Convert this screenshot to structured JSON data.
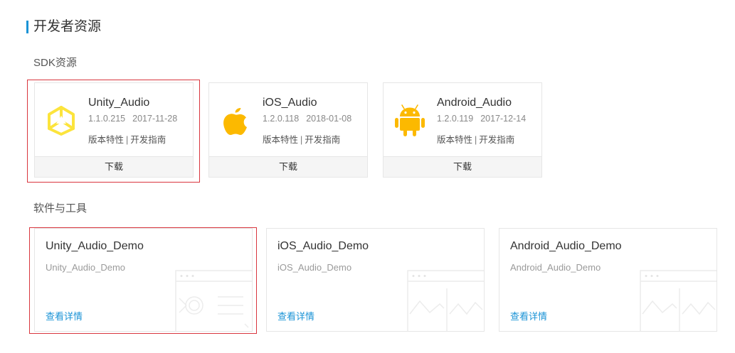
{
  "page_title": "开发者资源",
  "sdk_section": {
    "label": "SDK资源",
    "cards": [
      {
        "name": "Unity_Audio",
        "version": "1.1.0.215",
        "date": "2017-11-28",
        "release_notes": "版本特性",
        "separator": "|",
        "guide": "开发指南",
        "download": "下载",
        "icon": "unity-icon",
        "icon_color": "#fce43c"
      },
      {
        "name": "iOS_Audio",
        "version": "1.2.0.118",
        "date": "2018-01-08",
        "release_notes": "版本特性",
        "separator": "|",
        "guide": "开发指南",
        "download": "下载",
        "icon": "apple-icon",
        "icon_color": "#fcb900"
      },
      {
        "name": "Android_Audio",
        "version": "1.2.0.119",
        "date": "2017-12-14",
        "release_notes": "版本特性",
        "separator": "|",
        "guide": "开发指南",
        "download": "下载",
        "icon": "android-icon",
        "icon_color": "#fcb900"
      }
    ]
  },
  "tools_section": {
    "label": "软件与工具",
    "cards": [
      {
        "name": "Unity_Audio_Demo",
        "subtitle": "Unity_Audio_Demo",
        "link": "查看详情",
        "art": "window-illustration"
      },
      {
        "name": "iOS_Audio_Demo",
        "subtitle": "iOS_Audio_Demo",
        "link": "查看详情",
        "art": "chart-illustration"
      },
      {
        "name": "Android_Audio_Demo",
        "subtitle": "Android_Audio_Demo",
        "link": "查看详情",
        "art": "chart-illustration"
      }
    ]
  },
  "colors": {
    "accent": "#1a93d6",
    "highlight": "#d9363e",
    "icon_yellow": "#fcb900"
  }
}
